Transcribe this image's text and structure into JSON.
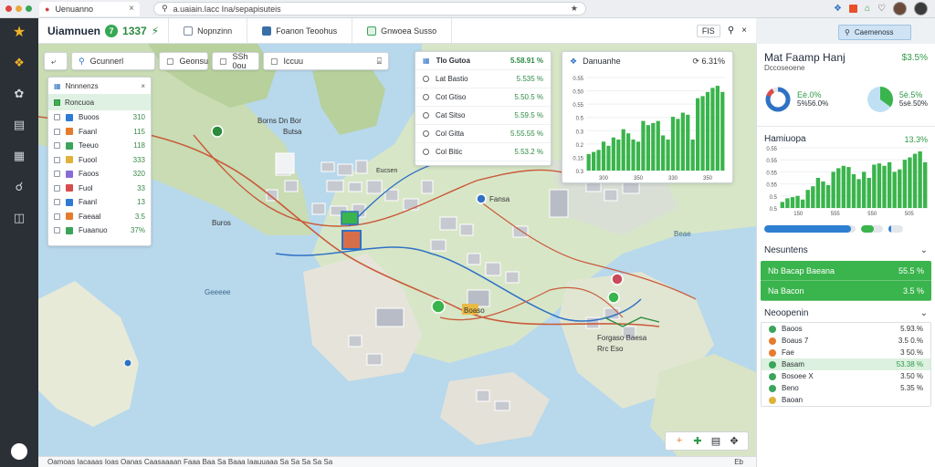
{
  "browser": {
    "tab_title": "Uenuanno",
    "url": "a.uaiain.Iacc Ina/sepapisuteis"
  },
  "toolbar": {
    "brand": "Uiamnuen",
    "brand_badge": "7",
    "brand_value": "1337",
    "brand_suffix": "⚡",
    "tabs": [
      "Nopnzinn",
      "Foanon Teoohus",
      "Gnwoea Susso"
    ],
    "view_button": "FIS"
  },
  "filters": {
    "f1": "Gcunnerl",
    "f2": "Geonsu",
    "f3": "SSh 0ou",
    "f4": "Iccuu"
  },
  "layers": {
    "title": "Nnnnenzs",
    "selected": "Roncuoa",
    "items": [
      {
        "label": "Buoos",
        "value": "310",
        "color": "#2e7bd6"
      },
      {
        "label": "Faanl",
        "value": "115",
        "color": "#e57b2d"
      },
      {
        "label": "Teeuo",
        "value": "118",
        "color": "#3aa55a"
      },
      {
        "label": "Fuool",
        "value": "333",
        "color": "#e0b23a"
      },
      {
        "label": "Faoos",
        "value": "320",
        "color": "#8a6ad8"
      },
      {
        "label": "Fuol",
        "value": "33",
        "color": "#d94c4c"
      },
      {
        "label": "Faanl",
        "value": "13",
        "color": "#2e7bd6"
      },
      {
        "label": "Faeaal",
        "value": "3.5",
        "color": "#e57b2d"
      },
      {
        "label": "Fuaanuo",
        "value": "37%",
        "color": "#3aa55a"
      }
    ]
  },
  "dropdown": {
    "header": {
      "label": "Tlo Gutoa",
      "value": "5.58.91 %"
    },
    "rows": [
      {
        "label": "Lat Bastio",
        "value": "5.535 %"
      },
      {
        "label": "Cot Gtiso",
        "value": "5.50.5 %"
      },
      {
        "label": "Cat Sitso",
        "value": "5.59.5 %"
      },
      {
        "label": "Col Gitta",
        "value": "5.55.55 %"
      },
      {
        "label": "Col Bitic",
        "value": "5.53.2 %"
      }
    ]
  },
  "chart_card": {
    "title": "Danuanhe",
    "value": "6.31%"
  },
  "chart_data": [
    {
      "type": "bar",
      "title": "",
      "y_ticks": [
        "0.55",
        "0.50",
        "0.55",
        "0.5",
        "0.3",
        "0.2",
        "0.15",
        "0.3"
      ],
      "x_ticks": [
        "300",
        "350",
        "330",
        "350"
      ],
      "values": [
        0.08,
        0.09,
        0.1,
        0.14,
        0.12,
        0.16,
        0.15,
        0.2,
        0.18,
        0.15,
        0.14,
        0.24,
        0.22,
        0.23,
        0.24,
        0.17,
        0.15,
        0.26,
        0.25,
        0.28,
        0.27,
        0.15,
        0.35,
        0.36,
        0.38,
        0.4,
        0.41,
        0.38
      ],
      "color": "#3ab44c",
      "ylim": [
        0,
        0.45
      ]
    },
    {
      "type": "bar",
      "title": "Hamiuopa",
      "y_ticks": [
        "0.55",
        "0.55",
        "0.55",
        "0.55",
        "0.5",
        "0.5"
      ],
      "x_ticks": [
        "150",
        "555",
        "550",
        "505"
      ],
      "values": [
        0.05,
        0.08,
        0.09,
        0.1,
        0.07,
        0.15,
        0.18,
        0.25,
        0.22,
        0.19,
        0.3,
        0.33,
        0.35,
        0.34,
        0.28,
        0.24,
        0.3,
        0.25,
        0.36,
        0.37,
        0.35,
        0.38,
        0.3,
        0.32,
        0.4,
        0.42,
        0.45,
        0.47,
        0.38
      ],
      "color": "#3ab44c",
      "ylim": [
        0,
        0.5
      ]
    }
  ],
  "panel": {
    "title": "Mat Faamp Hanj",
    "title_value": "$3.5%",
    "subtitle": "Dccoseoene",
    "donut1": {
      "value": "Eè.0%",
      "sub": "5%56.0%",
      "fraction": 0.82
    },
    "donut2": {
      "value": "5è.5%",
      "sub": "5sè.50%",
      "fraction": 0.35
    },
    "hist_title": "Hamiuopa",
    "hist_value": "13.3%",
    "progress": [
      0.95,
      0.6,
      0.2
    ],
    "section2": "Nesuntens",
    "green_rows": [
      {
        "label": "Nb Bacap Baeana",
        "value": "55.5 %"
      },
      {
        "label": "Na Bacon",
        "value": "3.5 %"
      }
    ],
    "section3": "Neoopenin",
    "list": [
      {
        "label": "Baoos",
        "value": "5.93.%",
        "color": "#3aa55a",
        "hl": false
      },
      {
        "label": "Boaus   7",
        "value": "3.5 0.%",
        "color": "#e57b2d",
        "hl": false
      },
      {
        "label": "Fae",
        "value": "3 50.%",
        "color": "#e57b2d",
        "hl": false
      },
      {
        "label": "Basam",
        "value": "53.38 %",
        "color": "#3aa55a",
        "hl": true
      },
      {
        "label": "Bosoee   X",
        "value": "3.50 %",
        "color": "#3aa55a",
        "hl": false
      },
      {
        "label": "Beno",
        "value": "5.35 %",
        "color": "#3aa55a",
        "hl": false
      },
      {
        "label": "Baoan",
        "value": "",
        "color": "#e0b23a",
        "hl": false
      }
    ]
  },
  "topsearch": "Caemenoss",
  "map_labels": {
    "l1": "Borns Dn Bor",
    "l2": "Butsa",
    "l3": "Buros",
    "l4": "Geeeee",
    "l5": "Beae",
    "l6": "Fansa",
    "l7": "Boaso",
    "l8": "Forgaso Baesa",
    "l9": "Rrc Eso",
    "l10": "Eucsen"
  },
  "status": {
    "text": "Oamoas  Iacaaas  Ioas  Oanas  Caasaaaan  Faaa  Baa  Sa  Baaa  Iaauuaaa  Sa  Sa  Sa  Sa  Sa",
    "right": "Eb"
  },
  "colors": {
    "accent": "#3ab44c",
    "water": "#b8d8ec",
    "land": "#d8e6c8",
    "route_red": "#c95b3a",
    "route_blue": "#2f72c4"
  }
}
